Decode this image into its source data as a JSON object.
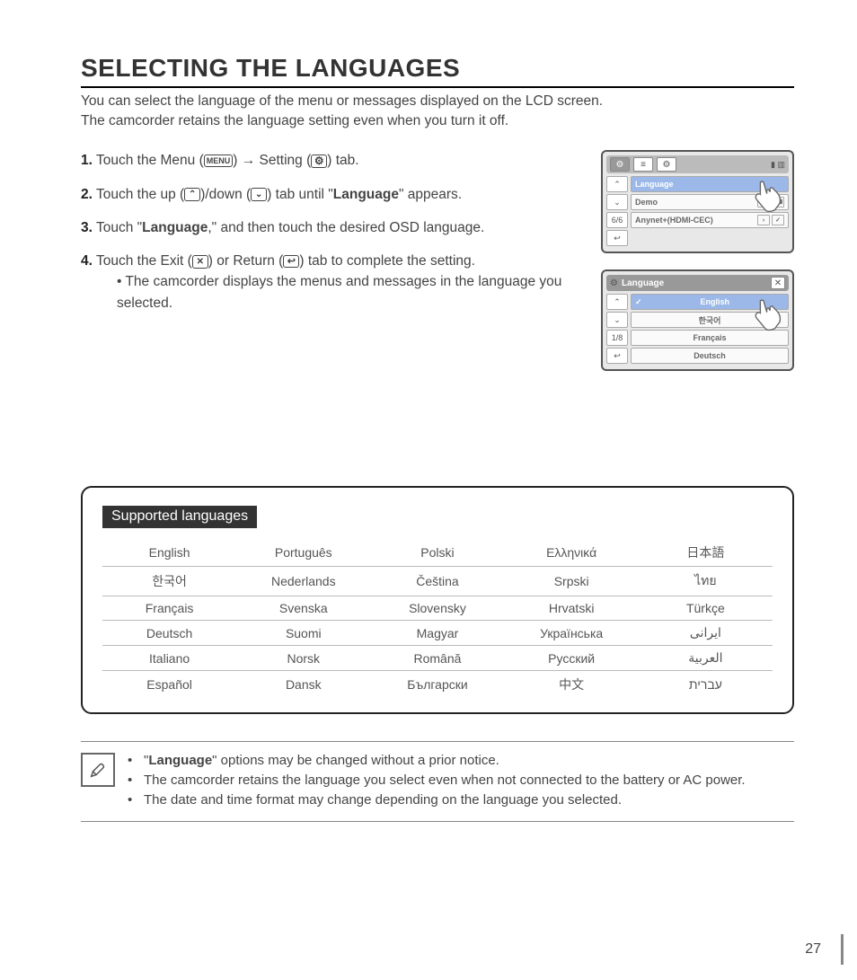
{
  "title": "SELECTING THE LANGUAGES",
  "intro": "You can select the language of the menu or messages displayed on the LCD screen.\nThe camcorder retains the language setting even when you turn it off.",
  "steps": {
    "s1": {
      "num": "1.",
      "pre": "Touch the Menu (",
      "menu_label": "MENU",
      "mid1": ") → Setting (",
      "after": ") tab."
    },
    "s2": {
      "num": "2.",
      "pre": "Touch the up (",
      "mid": ")/down (",
      "after1": ") tab until \"",
      "bold": "Language",
      "after2": "\" appears."
    },
    "s3": {
      "num": "3.",
      "pre": "Touch \"",
      "bold": "Language",
      "after": ",\" and then touch the desired OSD language."
    },
    "s4": {
      "num": "4.",
      "pre": "Touch the Exit (",
      "mid": ") or Return (",
      "after": ") tab to complete the setting.",
      "sub": "The camcorder displays the menus and messages in the language you selected."
    }
  },
  "lcd1": {
    "items": [
      "Language",
      "Demo",
      "Anynet+(HDMI-CEC)"
    ],
    "page": "6/6"
  },
  "lcd2": {
    "title": "Language",
    "items": [
      "English",
      "한국어",
      "Français",
      "Deutsch"
    ],
    "page": "1/8"
  },
  "supported_heading": " Supported languages ",
  "langs": [
    [
      "English",
      "Português",
      "Polski",
      "Ελληνικά",
      "日本語"
    ],
    [
      "한국어",
      "Nederlands",
      "Čeština",
      "Srpski",
      "ไทย"
    ],
    [
      "Français",
      "Svenska",
      "Slovensky",
      "Hrvatski",
      "Türkçe"
    ],
    [
      "Deutsch",
      "Suomi",
      "Magyar",
      "Українська",
      "ایرانی"
    ],
    [
      "Italiano",
      "Norsk",
      "Română",
      "Русский",
      "العربية"
    ],
    [
      "Español",
      "Dansk",
      "Български",
      "中文",
      "עברית"
    ]
  ],
  "notes": {
    "n1a": "\"",
    "n1b": "Language",
    "n1c": "\" options may be changed without a prior notice.",
    "n2": "The camcorder retains the language you select even when not connected to the battery or AC power.",
    "n3": "The date and time format may change depending on the language you selected."
  },
  "page_number": "27"
}
